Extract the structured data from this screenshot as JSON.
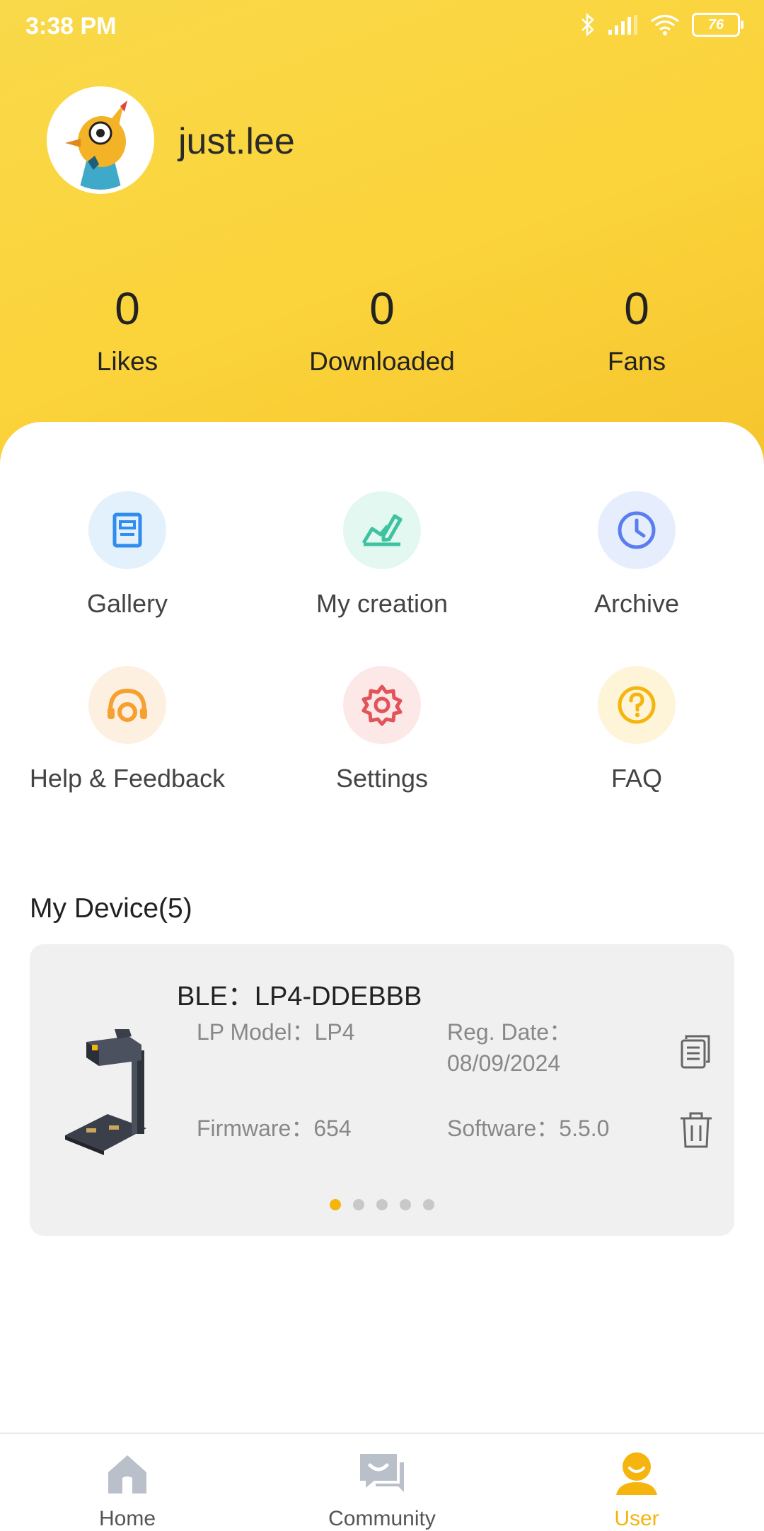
{
  "status_bar": {
    "time": "3:38 PM",
    "battery": "76"
  },
  "profile": {
    "username": "just.lee"
  },
  "stats": [
    {
      "value": "0",
      "label": "Likes"
    },
    {
      "value": "0",
      "label": "Downloaded"
    },
    {
      "value": "0",
      "label": "Fans"
    }
  ],
  "menu": [
    {
      "label": "Gallery",
      "icon": "gallery-icon",
      "color": "#2f8cf0",
      "bg": "#e3f1fd"
    },
    {
      "label": "My creation",
      "icon": "pen-icon",
      "color": "#3ec2a0",
      "bg": "#e2f8f1"
    },
    {
      "label": "Archive",
      "icon": "clock-icon",
      "color": "#5a7ef0",
      "bg": "#e6edfd"
    },
    {
      "label": "Help & Feedback",
      "icon": "headset-icon",
      "color": "#f5a030",
      "bg": "#fef0e1"
    },
    {
      "label": "Settings",
      "icon": "gear-icon",
      "color": "#e0545a",
      "bg": "#fde8e8"
    },
    {
      "label": "FAQ",
      "icon": "question-icon",
      "color": "#f5b50e",
      "bg": "#fef5d9"
    }
  ],
  "devices": {
    "title": "My Device(5)",
    "current": {
      "name": "BLE：LP4-DDEBBB",
      "model": "LP Model：LP4",
      "reg_date_label": "Reg. Date：",
      "reg_date": "08/09/2024",
      "firmware": "Firmware：654",
      "software": "Software：5.5.0"
    },
    "page_count": 5,
    "active_page": 0
  },
  "nav": [
    {
      "label": "Home",
      "icon": "home-icon"
    },
    {
      "label": "Community",
      "icon": "community-icon"
    },
    {
      "label": "User",
      "icon": "user-icon"
    }
  ],
  "colors": {
    "accent": "#f5b50e",
    "header": "#fbd33a"
  }
}
